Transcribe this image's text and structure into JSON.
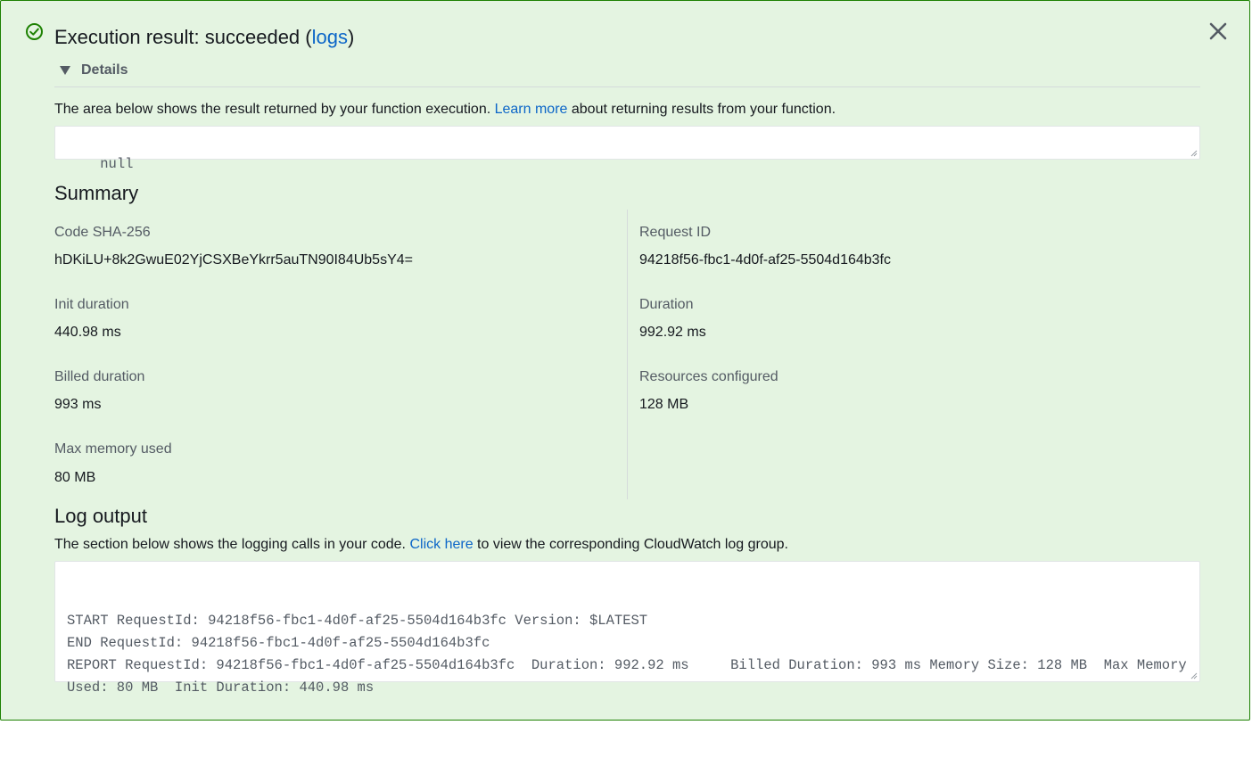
{
  "result": {
    "title_prefix": "Execution result: succeeded (",
    "title_link": "logs",
    "title_suffix": ")",
    "status_icon": "check-circle-icon",
    "close_icon": "close-icon",
    "details_label": "Details",
    "description_before": "The area below shows the result returned by your function execution. ",
    "description_link": "Learn more",
    "description_after": " about returning results from your function.",
    "output_value": "null"
  },
  "summary": {
    "heading": "Summary",
    "left": [
      {
        "label": "Code SHA-256",
        "value": "hDKiLU+8k2GwuE02YjCSXBeYkrr5auTN90I84Ub5sY4="
      },
      {
        "label": "Init duration",
        "value": "440.98 ms"
      },
      {
        "label": "Billed duration",
        "value": "993 ms"
      },
      {
        "label": "Max memory used",
        "value": "80 MB"
      }
    ],
    "right": [
      {
        "label": "Request ID",
        "value": "94218f56-fbc1-4d0f-af25-5504d164b3fc"
      },
      {
        "label": "Duration",
        "value": "992.92 ms"
      },
      {
        "label": "Resources configured",
        "value": "128 MB"
      }
    ]
  },
  "log_output": {
    "heading": "Log output",
    "description_before": "The section below shows the logging calls in your code. ",
    "description_link": "Click here",
    "description_after": " to view the corresponding CloudWatch log group.",
    "lines": "START RequestId: 94218f56-fbc1-4d0f-af25-5504d164b3fc Version: $LATEST\nEND RequestId: 94218f56-fbc1-4d0f-af25-5504d164b3fc\nREPORT RequestId: 94218f56-fbc1-4d0f-af25-5504d164b3fc  Duration: 992.92 ms     Billed Duration: 993 ms Memory Size: 128 MB  Max Memory Used: 80 MB  Init Duration: 440.98 ms"
  },
  "colors": {
    "success_background": "#e4f4e1",
    "success_border": "#1d8102",
    "link": "#0c66c8"
  }
}
